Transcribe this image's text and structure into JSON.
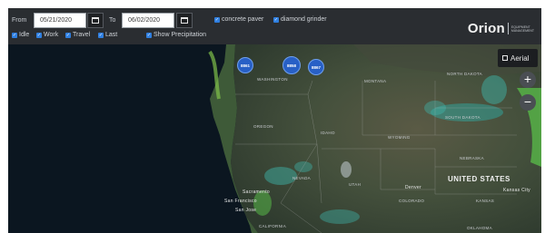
{
  "toolbar": {
    "from_label": "From",
    "from_date": "05/21/2020",
    "to_label": "To",
    "to_date": "06/02/2020",
    "equipment_filters": [
      {
        "label": "concrete paver",
        "checked": true
      },
      {
        "label": "diamond grinder",
        "checked": true
      }
    ],
    "status_filters": [
      {
        "label": "Idle",
        "checked": true
      },
      {
        "label": "Work",
        "checked": true
      },
      {
        "label": "Travel",
        "checked": true
      },
      {
        "label": "Last",
        "checked": true
      }
    ],
    "precipitation": {
      "label": "Show Precipitation",
      "checked": true
    }
  },
  "logo": {
    "word": "Orion",
    "sub_line1": "EQUIPMENT",
    "sub_line2": "MANAGEMENT"
  },
  "map": {
    "layer_button": "Aerial",
    "zoom_in": "+",
    "zoom_out": "−",
    "pins": [
      "8861",
      "8858",
      "8867"
    ],
    "labels": {
      "washington": "WASHINGTON",
      "oregon": "OREGON",
      "montana": "MONTANA",
      "idaho": "IDAHO",
      "wyoming": "WYOMING",
      "north_dakota": "NORTH DAKOTA",
      "south_dakota": "SOUTH DAKOTA",
      "nebraska": "NEBRASKA",
      "colorado": "COLORADO",
      "kansas": "KANSAS",
      "oklahoma": "OKLAHOMA",
      "nevada": "NEVADA",
      "utah": "UTAH",
      "california": "CALIFORNIA",
      "united_states": "UNITED STATES",
      "denver": "Denver",
      "sacramento": "Sacramento",
      "san_francisco": "San Francisco",
      "san_jose": "San Jose",
      "kansas_city": "Kansas City"
    },
    "colors": {
      "ocean": "#0b1620",
      "land": "#3b4a3a",
      "pin": "#2860c6",
      "accent": "#2f7fe0"
    }
  }
}
